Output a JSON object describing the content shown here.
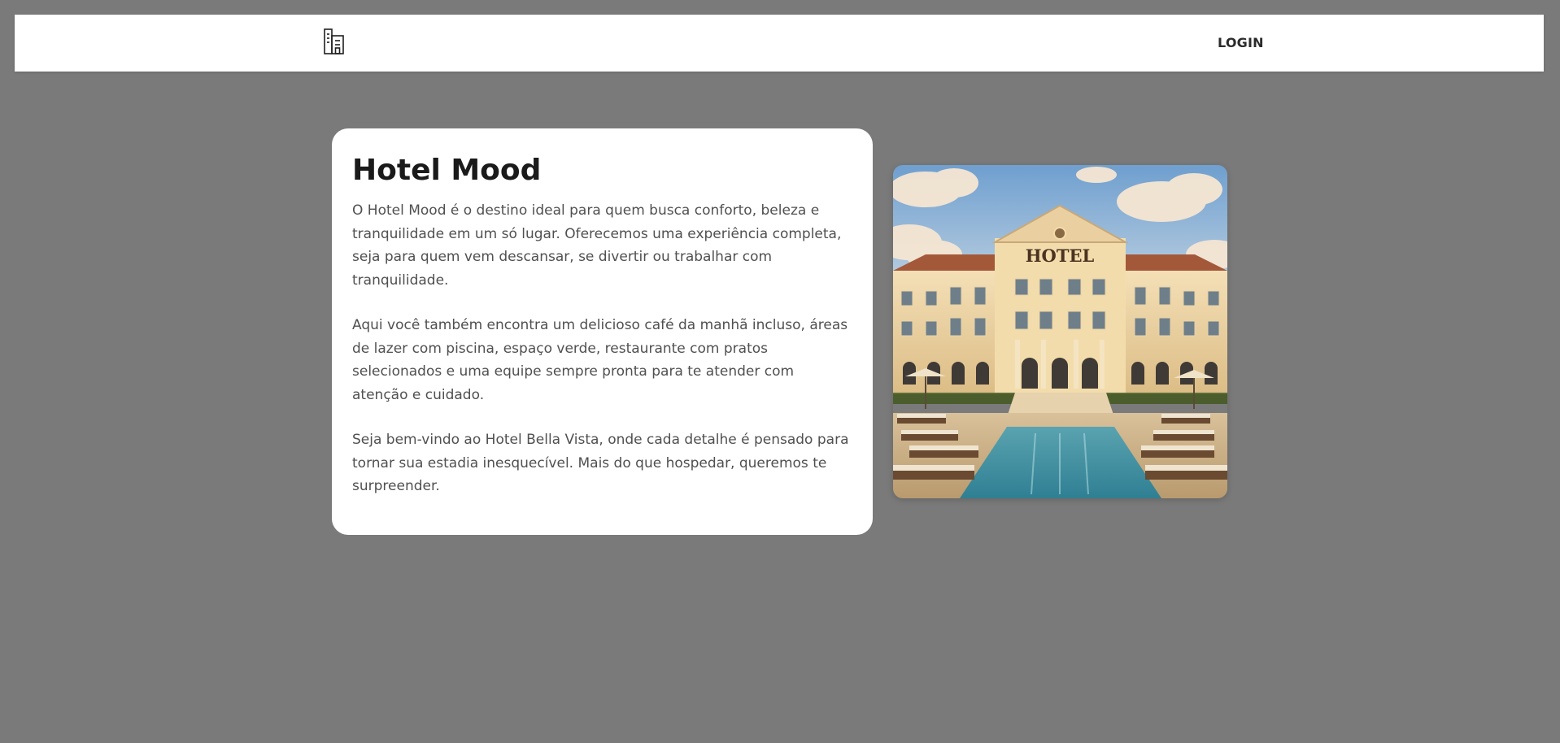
{
  "navbar": {
    "logo_icon": "building-icon",
    "login_label": "LOGIN"
  },
  "content": {
    "title": "Hotel Mood",
    "paragraphs": [
      "O Hotel Mood é o destino ideal para quem busca conforto, beleza e tranquilidade em um só lugar. Oferecemos uma experiência completa, seja para quem vem descansar, se divertir ou trabalhar com tranquilidade.",
      "Aqui você também encontra um delicioso café da manhã incluso, áreas de lazer com piscina, espaço verde, restaurante com pratos selecionados e uma equipe sempre pronta para te atender com atenção e cuidado.",
      "Seja bem-vindo ao Hotel Bella Vista, onde cada detalhe é pensado para tornar sua estadia inesquecível. Mais do que hospedar, queremos te surpreender."
    ]
  },
  "photo": {
    "sign_text": "HOTEL"
  },
  "colors": {
    "page_background": "#7a7a7a",
    "surface": "#ffffff",
    "title_text": "#1a1a1a",
    "body_text": "#505050"
  }
}
